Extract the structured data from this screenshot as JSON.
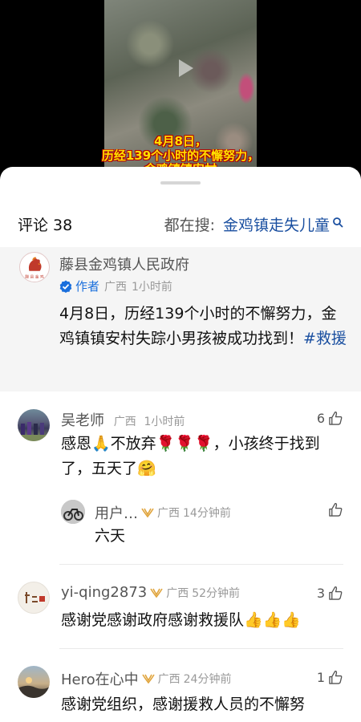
{
  "video": {
    "subtitle_line1": "4月8日，",
    "subtitle_line2": "历经139个小时的不懈努力，",
    "subtitle_line3": "金鸡镇镇安村"
  },
  "header": {
    "comments_label": "评论 38",
    "search_prefix": "都在搜:",
    "search_term": "金鸡镇走失儿童"
  },
  "pinned": {
    "username": "藤县金鸡镇人民政府",
    "author_badge": "作者",
    "location": "广西",
    "time": "1小时前",
    "text_main": "4月8日，历经139个小时的不懈努力，金鸡镇镇安村失踪小男孩被成功找到！",
    "hashtag": "#救援"
  },
  "comments": [
    {
      "username": "吴老师",
      "location": "广西",
      "time": "1小时前",
      "likes": "6",
      "text": "感恩🙏不放弃🌹🌹🌹，小孩终于找到了，五天了🤗",
      "reply": {
        "username": "用户…",
        "location": "广西",
        "time": "14分钟前",
        "likes": "",
        "text": "六天"
      }
    },
    {
      "username": "yi-qing2873",
      "location": "广西",
      "time": "52分钟前",
      "likes": "3",
      "text": "感谢党感谢政府感谢救援队👍👍👍"
    },
    {
      "username": "Hero在心中",
      "location": "广西",
      "time": "24分钟前",
      "likes": "1",
      "text": "感谢党组织，感谢援救人员的不懈努"
    }
  ],
  "colors": {
    "link_blue": "#1a4fa0",
    "author_blue": "#1a6fdc",
    "subtitle_yellow": "#ffe000",
    "vip_gold": "#e0a43c"
  }
}
